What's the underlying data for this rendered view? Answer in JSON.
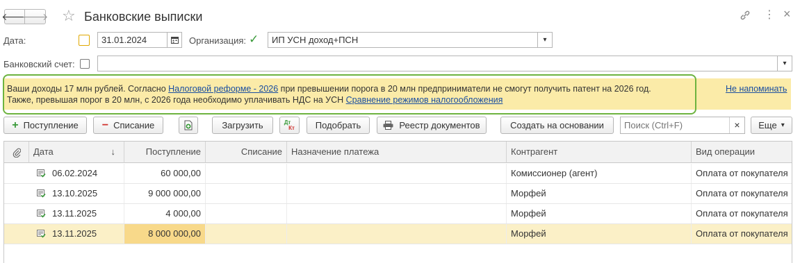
{
  "window": {
    "title": "Банковские выписки",
    "nav": {
      "back_icon": "arrow-left-icon",
      "forward_icon": "arrow-right-icon"
    },
    "icons": [
      "star-icon",
      "link-icon",
      "more-vertical-icon",
      "close-icon"
    ],
    "star_glyph": "☆",
    "link_glyph": "🔗",
    "more_glyph": "⋮",
    "close_glyph": "×",
    "back_glyph": "🡐",
    "fwd_glyph": "🡒"
  },
  "filters": {
    "date_label": "Дата:",
    "date_checked": false,
    "date_value": "31.01.2024",
    "org_label": "Организация:",
    "org_checked": true,
    "org_value": "ИП УСН доход+ПСН",
    "bank_label": "Банковский счет:",
    "bank_checked": false,
    "bank_value": "",
    "check_glyph": "✓",
    "dropdown_glyph": "▾",
    "calendar_glyph": "▦"
  },
  "banner": {
    "line1_pre": "Ваши доходы 17 млн рублей. Согласно ",
    "line1_link": "Налоговой реформе - 2026",
    "line1_post": " при превышении порога в 20 млн предприниматели не смогут получить патент на 2026 год.",
    "line2_pre": "Также, превышая порог в 20 млн, с 2026 года необходимо уплачивать НДС на УСН  ",
    "line2_link": "Сравнение режимов налогообложения",
    "dismiss_link": "Не напоминать"
  },
  "toolbar": {
    "income_label": "Поступление",
    "income_glyph": "+",
    "expense_label": "Списание",
    "expense_glyph": "−",
    "load_label": "Загрузить",
    "pick_label": "Подобрать",
    "registry_label": "Реестр документов",
    "create_based_label": "Создать на основании",
    "search_placeholder": "Поиск (Ctrl+F)",
    "search_clear_glyph": "×",
    "more_label": "Еще",
    "more_glyph": "▾",
    "dtkt_top": "Дт",
    "dtkt_bottom": "Кт"
  },
  "table": {
    "columns": {
      "attach_glyph": "📎",
      "date": "Дата",
      "sort_glyph": "↓",
      "income": "Поступление",
      "expense": "Списание",
      "purpose": "Назначение платежа",
      "counterparty": "Контрагент",
      "operation": "Вид операции"
    },
    "rows": [
      {
        "date": "06.02.2024",
        "income": "60 000,00",
        "expense": "",
        "purpose": "",
        "counterparty": "Комиссионер (агент)",
        "operation": "Оплата от покупателя"
      },
      {
        "date": "13.10.2025",
        "income": "9 000 000,00",
        "expense": "",
        "purpose": "",
        "counterparty": "Морфей",
        "operation": "Оплата от покупателя"
      },
      {
        "date": "13.11.2025",
        "income": "4 000,00",
        "expense": "",
        "purpose": "",
        "counterparty": "Морфей",
        "operation": "Оплата от покупателя"
      },
      {
        "date": "13.11.2025",
        "income": "8 000 000,00",
        "expense": "",
        "purpose": "",
        "counterparty": "Морфей",
        "operation": "Оплата от покупателя"
      }
    ],
    "selected_row": 3
  },
  "colors": {
    "banner_bg": "#fbeba8",
    "banner_border": "#6db33f",
    "selected_row": "#fbf0c7",
    "selected_cell": "#f8d98a",
    "link": "#1a4ea0",
    "income_icon": "#3a9a3a",
    "expense_icon": "#d0312d"
  }
}
